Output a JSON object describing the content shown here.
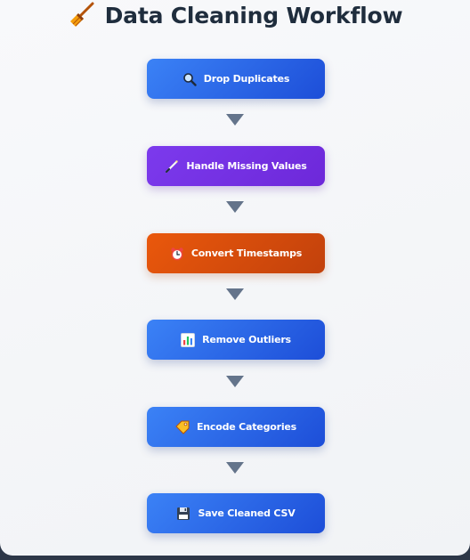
{
  "title": "Data Cleaning Workflow",
  "title_icon": "broom-icon",
  "steps": [
    {
      "label": "Drop Duplicates",
      "icon": "magnifier-icon",
      "color": "#2563eb"
    },
    {
      "label": "Handle Missing Values",
      "icon": "wand-icon",
      "color": "#6d28d9"
    },
    {
      "label": "Convert Timestamps",
      "icon": "alarm-clock-icon",
      "color": "#dc4f0c"
    },
    {
      "label": "Remove Outliers",
      "icon": "bar-chart-icon",
      "color": "#2563eb"
    },
    {
      "label": "Encode Categories",
      "icon": "tag-icon",
      "color": "#2563eb"
    },
    {
      "label": "Save Cleaned CSV",
      "icon": "floppy-disk-icon",
      "color": "#2563eb"
    }
  ],
  "arrow_color": "#64748b"
}
